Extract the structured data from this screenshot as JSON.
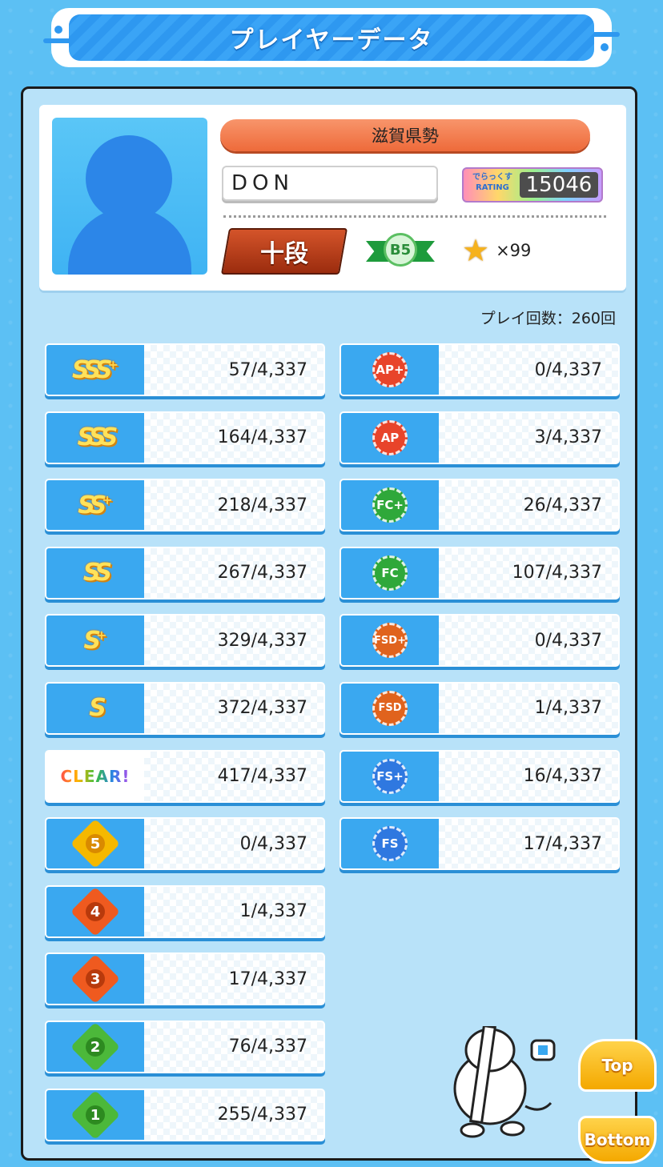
{
  "header": {
    "title": "プレイヤーデータ"
  },
  "profile": {
    "region": "滋賀県勢",
    "name": "DON",
    "rating_label_top": "でらっくす",
    "rating_label_bottom": "RATING",
    "rating_value": "15046",
    "dan": "十段",
    "class_badge": "B5",
    "star_count": "×99"
  },
  "play_count": "プレイ回数：260回",
  "left_stats": [
    {
      "icon": "sss-plus-rank-icon",
      "label": "SSS",
      "sup": "+",
      "value": "57/4,337"
    },
    {
      "icon": "sss-rank-icon",
      "label": "SSS",
      "sup": "",
      "value": "164/4,337"
    },
    {
      "icon": "ss-plus-rank-icon",
      "label": "SS",
      "sup": "+",
      "value": "218/4,337"
    },
    {
      "icon": "ss-rank-icon",
      "label": "SS",
      "sup": "",
      "value": "267/4,337"
    },
    {
      "icon": "s-plus-rank-icon",
      "label": "S",
      "sup": "+",
      "value": "329/4,337"
    },
    {
      "icon": "s-rank-icon",
      "label": "S",
      "sup": "",
      "value": "372/4,337"
    },
    {
      "icon": "clear-icon",
      "label": "CLEAR!",
      "sup": "",
      "value": "417/4,337"
    },
    {
      "icon": "dx-star-5-icon",
      "label": "5",
      "sup": "",
      "value": "0/4,337",
      "color": "#f5b800"
    },
    {
      "icon": "dx-star-4-icon",
      "label": "4",
      "sup": "",
      "value": "1/4,337",
      "color": "#ef5a1f"
    },
    {
      "icon": "dx-star-3-icon",
      "label": "3",
      "sup": "",
      "value": "17/4,337",
      "color": "#ef5a1f"
    },
    {
      "icon": "dx-star-2-icon",
      "label": "2",
      "sup": "",
      "value": "76/4,337",
      "color": "#4cb83a"
    },
    {
      "icon": "dx-star-1-icon",
      "label": "1",
      "sup": "",
      "value": "255/4,337",
      "color": "#4cb83a"
    }
  ],
  "right_stats": [
    {
      "icon": "ap-plus-icon",
      "label": "AP+",
      "value": "0/4,337",
      "color": "#e8442a"
    },
    {
      "icon": "ap-icon",
      "label": "AP",
      "value": "3/4,337",
      "color": "#e8442a"
    },
    {
      "icon": "fc-plus-icon",
      "label": "FC+",
      "value": "26/4,337",
      "color": "#2fa83a"
    },
    {
      "icon": "fc-icon",
      "label": "FC",
      "value": "107/4,337",
      "color": "#2fa83a"
    },
    {
      "icon": "fsd-plus-icon",
      "label": "FSD+",
      "value": "0/4,337",
      "color": "#e0631d"
    },
    {
      "icon": "fsd-icon",
      "label": "FSD",
      "value": "1/4,337",
      "color": "#e0631d"
    },
    {
      "icon": "fs-plus-icon",
      "label": "FS+",
      "value": "16/4,337",
      "color": "#2f78e0"
    },
    {
      "icon": "fs-icon",
      "label": "FS",
      "value": "17/4,337",
      "color": "#2f78e0"
    }
  ],
  "nav": {
    "top": "Top",
    "bottom": "Bottom"
  }
}
